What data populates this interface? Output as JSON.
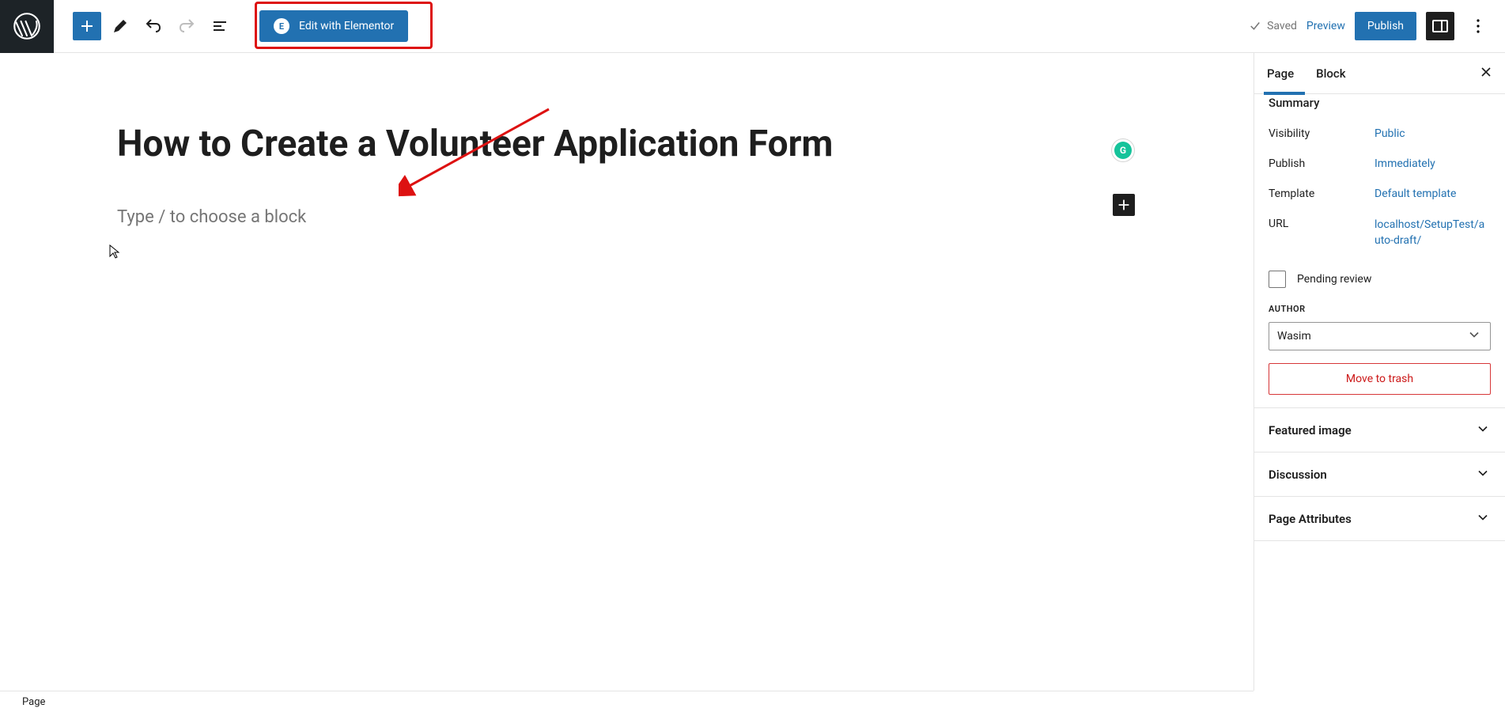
{
  "toolbar": {
    "elementor_label": "Edit with Elementor",
    "saved_label": "Saved",
    "preview_label": "Preview",
    "publish_label": "Publish"
  },
  "canvas": {
    "title": "How to Create a Volunteer Application Form",
    "block_placeholder": "Type / to choose a block",
    "grammarly_initial": "G"
  },
  "sidebar": {
    "tab_page": "Page",
    "tab_block": "Block",
    "summary_label": "Summary",
    "visibility_label": "Visibility",
    "visibility_value": "Public",
    "publish_label": "Publish",
    "publish_value": "Immediately",
    "template_label": "Template",
    "template_value": "Default template",
    "url_label": "URL",
    "url_value": "localhost/SetupTest/auto-draft/",
    "pending_label": "Pending review",
    "author_label": "AUTHOR",
    "author_value": "Wasim",
    "trash_label": "Move to trash",
    "featured_image_label": "Featured image",
    "discussion_label": "Discussion",
    "page_attributes_label": "Page Attributes"
  },
  "footer": {
    "breadcrumb": "Page"
  }
}
